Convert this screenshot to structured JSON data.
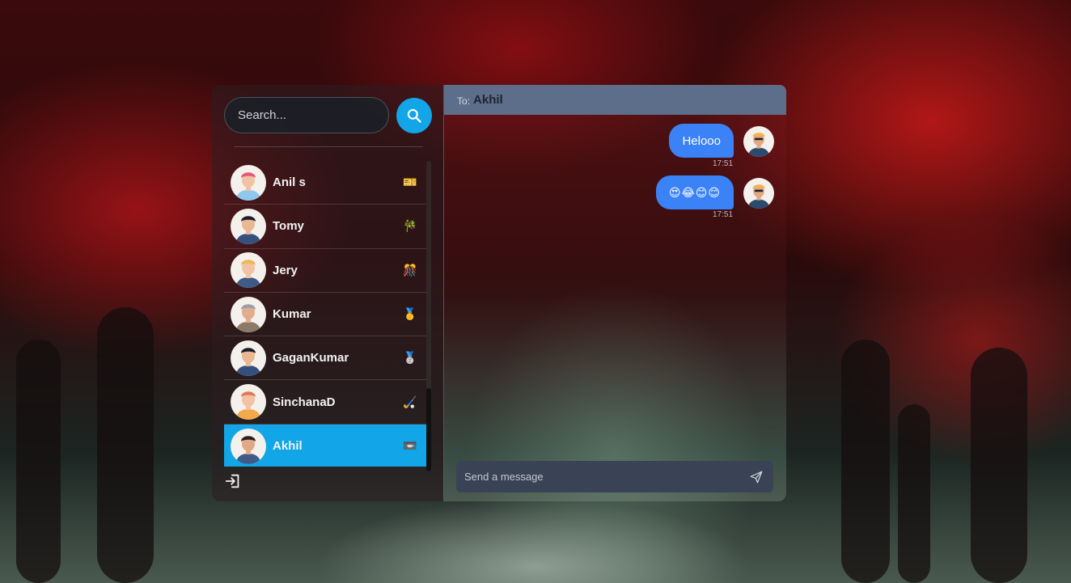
{
  "sidebar": {
    "search": {
      "placeholder": "Search..."
    },
    "contacts": [
      {
        "name": "Anil s",
        "badge": "🎫",
        "avatar": "avatar-anil",
        "shirt": "#8fc7ef",
        "hair": "#e45a78",
        "skin": "#f2c2a4"
      },
      {
        "name": "Tomy",
        "badge": "🎋",
        "avatar": "avatar-tomy",
        "shirt": "#35507e",
        "hair": "#1e1e2a",
        "skin": "#e9b893"
      },
      {
        "name": "Jery",
        "badge": "🎊",
        "avatar": "avatar-jery",
        "shirt": "#3f5a86",
        "hair": "#f0b64f",
        "skin": "#f2c2a4"
      },
      {
        "name": "Kumar",
        "badge": "🥇",
        "avatar": "avatar-kumar",
        "shirt": "#8a7a66",
        "hair": "#9ca0a6",
        "skin": "#e2ad8c"
      },
      {
        "name": "GaganKumar",
        "badge": "🥈",
        "avatar": "avatar-gagankumar",
        "shirt": "#35507e",
        "hair": "#1e1e2a",
        "skin": "#e9b893"
      },
      {
        "name": "SinchanaD",
        "badge": "🏑",
        "avatar": "avatar-sinchanad",
        "shirt": "#f2a84b",
        "hair": "#e07a5a",
        "skin": "#f2c2a4"
      },
      {
        "name": "Akhil",
        "badge": "📼",
        "avatar": "avatar-akhil",
        "shirt": "#3f5a86",
        "hair": "#2a1e1e",
        "skin": "#e2a884",
        "active": true
      }
    ]
  },
  "chat": {
    "to_label": "To:",
    "to_name": "Akhil",
    "messages": [
      {
        "text": "Helooo",
        "time": "17:51"
      },
      {
        "text": "😍😂😊😊",
        "time": "17:51"
      }
    ],
    "composer": {
      "placeholder": "Send a message"
    }
  },
  "colors": {
    "accent": "#12a6e8",
    "bubble": "#3b82f6",
    "header": "#5c6e8a",
    "composer": "#3a4355"
  },
  "icons": [
    "search-icon",
    "logout-icon",
    "send-icon"
  ]
}
